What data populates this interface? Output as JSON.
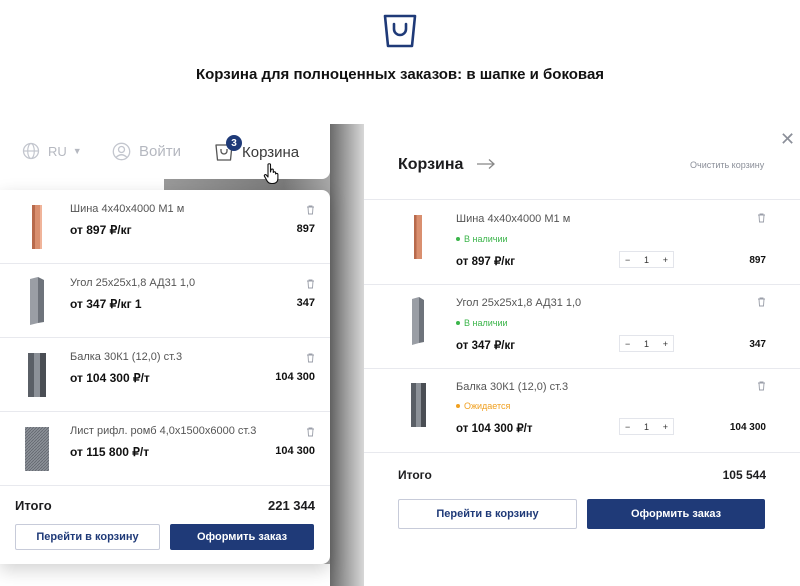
{
  "page": {
    "title": "Корзина для полноценных заказов: в шапке и боковая"
  },
  "colors": {
    "accent": "#1f3a78",
    "in_stock": "#3bb54a",
    "expected": "#f0a020"
  },
  "header": {
    "lang": "RU",
    "login": "Войти",
    "cart_label": "Корзина",
    "cart_count": "3"
  },
  "dropdown": {
    "items": [
      {
        "name": "Шина 4x40x4000 М1 м",
        "price": "от 897 ₽/кг",
        "total": "897"
      },
      {
        "name": "Угол 25х25х1,8 АД31 1,0",
        "price": "от 347 ₽/кг   1",
        "total": "347"
      },
      {
        "name": "Балка 30К1 (12,0) ст.3",
        "price": "от 104 300 ₽/т",
        "total": "104 300"
      },
      {
        "name": "Лист рифл. ромб 4,0х1500х6000 ст.3",
        "price": "от 115 800 ₽/т",
        "total": "104 300"
      }
    ],
    "total_label": "Итого",
    "total_value": "221 344",
    "go_to_cart": "Перейти в корзину",
    "checkout": "Оформить заказ"
  },
  "side": {
    "title": "Корзина",
    "clear": "Очистить корзину",
    "items": [
      {
        "name": "Шина 4x40x4000 М1 м",
        "status": "В наличии",
        "price": "от 897 ₽/кг",
        "qty": "1",
        "total": "897"
      },
      {
        "name": "Угол 25х25х1,8 АД31 1,0",
        "status": "В наличии",
        "price": "от 347 ₽/кг",
        "qty": "1",
        "total": "347"
      },
      {
        "name": "Балка 30К1 (12,0) ст.3",
        "status": "Ожидается",
        "price": "от 104 300 ₽/т",
        "qty": "1",
        "total": "104 300"
      }
    ],
    "total_label": "Итого",
    "total_value": "105 544",
    "go_to_cart": "Перейти в корзину",
    "checkout": "Оформить заказ"
  }
}
